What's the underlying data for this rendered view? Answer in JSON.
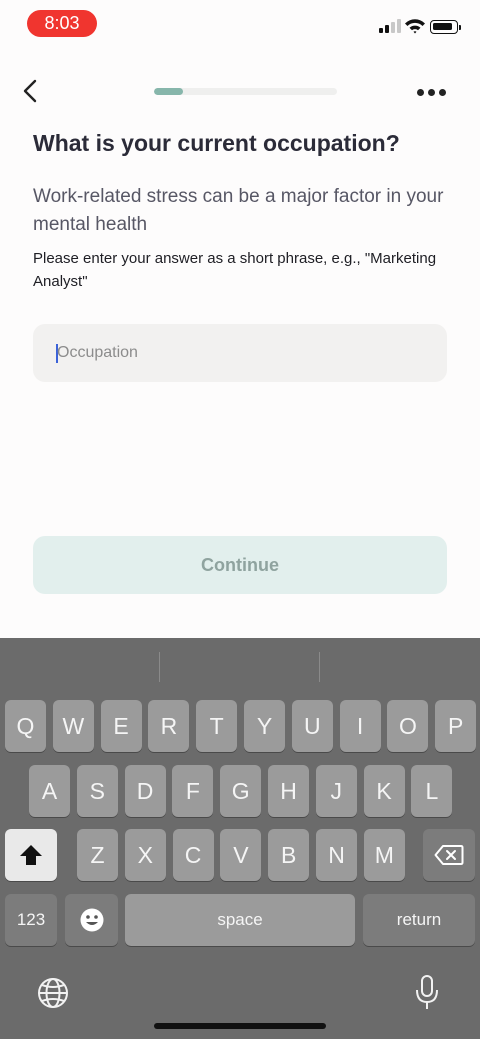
{
  "status_bar": {
    "time": "8:03"
  },
  "header": {
    "progress_percent": 16
  },
  "question": {
    "title": "What is your current occupation?",
    "subtitle": "Work-related stress can be a major factor in your mental health",
    "hint": "Please enter your answer as a short phrase, e.g., \"Marketing Analyst\""
  },
  "occupation_input": {
    "placeholder": "Occupation",
    "value": ""
  },
  "continue_label": "Continue",
  "keyboard": {
    "row1": [
      "Q",
      "W",
      "E",
      "R",
      "T",
      "Y",
      "U",
      "I",
      "O",
      "P"
    ],
    "row2": [
      "A",
      "S",
      "D",
      "F",
      "G",
      "H",
      "J",
      "K",
      "L"
    ],
    "row3": [
      "Z",
      "X",
      "C",
      "V",
      "B",
      "N",
      "M"
    ],
    "numbers_label": "123",
    "space_label": "space",
    "return_label": "return"
  }
}
